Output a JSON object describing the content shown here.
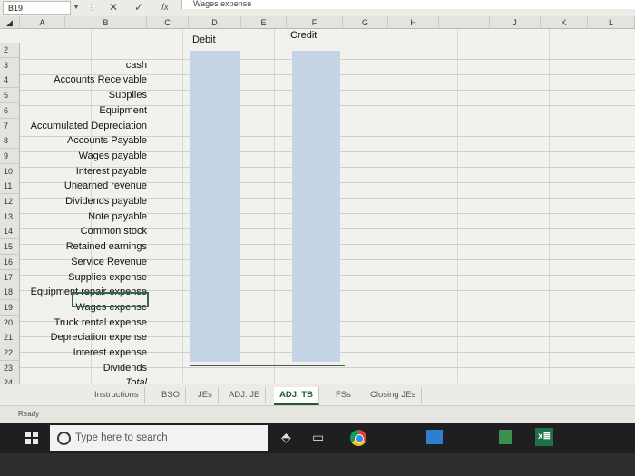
{
  "formula_bar": {
    "name_box": "B19",
    "content": "Wages expense",
    "cancel_icon": "✕",
    "enter_icon": "✓",
    "fx_label": "fx"
  },
  "columns": [
    "A",
    "B",
    "C",
    "D",
    "E",
    "F",
    "G",
    "H",
    "I",
    "J",
    "K",
    "L"
  ],
  "header_cells": {
    "debit": "Debit",
    "credit": "Credit"
  },
  "rows": [
    {
      "num": "2",
      "label": ""
    },
    {
      "num": "3",
      "label": "cash"
    },
    {
      "num": "4",
      "label": "Accounts Receivable"
    },
    {
      "num": "5",
      "label": "Supplies"
    },
    {
      "num": "6",
      "label": "Equipment"
    },
    {
      "num": "7",
      "label": "Accumulated Depreciation"
    },
    {
      "num": "8",
      "label": "Accounts Payable"
    },
    {
      "num": "9",
      "label": "Wages payable"
    },
    {
      "num": "10",
      "label": "Interest payable"
    },
    {
      "num": "11",
      "label": "Unearned revenue"
    },
    {
      "num": "12",
      "label": "Dividends payable"
    },
    {
      "num": "13",
      "label": "Note payable"
    },
    {
      "num": "14",
      "label": "Common stock"
    },
    {
      "num": "15",
      "label": "Retained earnings"
    },
    {
      "num": "16",
      "label": "Service Revenue"
    },
    {
      "num": "17",
      "label": "Supplies expense"
    },
    {
      "num": "18",
      "label": "Equipment repair expense"
    },
    {
      "num": "19",
      "label": "Wages expense"
    },
    {
      "num": "20",
      "label": "Truck rental expense"
    },
    {
      "num": "21",
      "label": "Depreciation expense"
    },
    {
      "num": "22",
      "label": "Interest expense"
    },
    {
      "num": "23",
      "label": "Dividends"
    },
    {
      "num": "24",
      "label": "Total"
    }
  ],
  "sheet_tabs": [
    "Instructions",
    "BSO",
    "JEs",
    "ADJ. JE",
    "ADJ. TB",
    "FSs",
    "Closing JEs"
  ],
  "active_tab": "ADJ. TB",
  "status": "Ready",
  "taskbar": {
    "search_placeholder": "Type here to search",
    "excel_label": "x≣"
  },
  "colors": {
    "accent_green": "#1e5c2f",
    "column_fill": "#c5d4e4"
  }
}
